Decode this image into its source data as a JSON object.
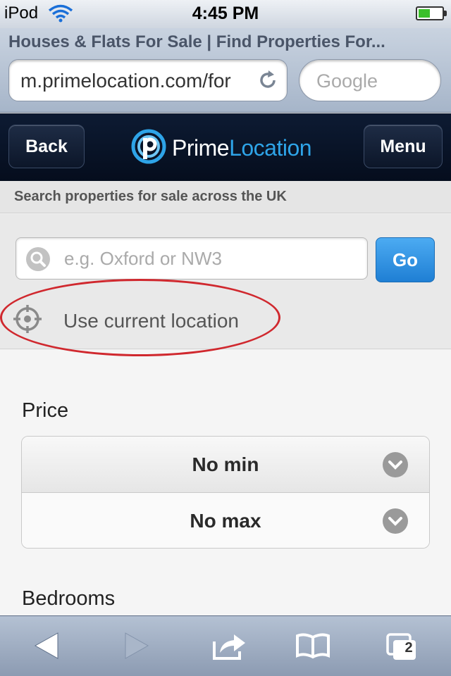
{
  "status_bar": {
    "carrier": "iPod",
    "time": "4:45 PM",
    "battery_level": 0.5
  },
  "browser": {
    "page_title": "Houses & Flats For Sale | Find Properties For...",
    "url": "m.primelocation.com/for",
    "search_placeholder": "Google"
  },
  "site": {
    "back_label": "Back",
    "menu_label": "Menu",
    "logo_part1": "Prime",
    "logo_part2": "Location",
    "tagline": "Search properties for sale across the UK",
    "accent_color": "#2ea4e8"
  },
  "search": {
    "placeholder": "e.g. Oxford or NW3",
    "go_label": "Go",
    "use_location_label": "Use current location"
  },
  "filters": {
    "price_label": "Price",
    "price_min": "No min",
    "price_max": "No max",
    "bedrooms_label": "Bedrooms"
  },
  "toolbar": {
    "icons": [
      "back-arrow-icon",
      "forward-arrow-icon",
      "share-icon",
      "bookmarks-icon",
      "tabs-icon"
    ],
    "tab_count": "2"
  },
  "annotation_color": "#d0282e"
}
